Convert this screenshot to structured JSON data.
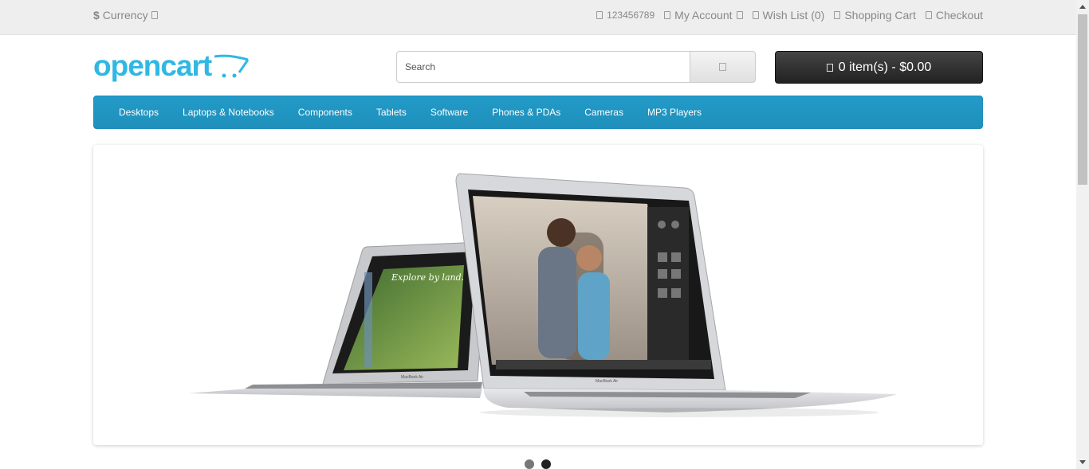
{
  "topbar": {
    "currency_symbol": "$",
    "currency_label": "Currency",
    "phone": "123456789",
    "my_account": "My Account",
    "wish_list": "Wish List (0)",
    "shopping_cart": "Shopping Cart",
    "checkout": "Checkout"
  },
  "header": {
    "logo_text": "opencart",
    "search_placeholder": "Search",
    "cart_label": "0 item(s) - $0.00"
  },
  "menu": {
    "items": [
      "Desktops",
      "Laptops & Notebooks",
      "Components",
      "Tablets",
      "Software",
      "Phones & PDAs",
      "Cameras",
      "MP3 Players"
    ]
  },
  "slideshow": {
    "left_screen_text": "Explore by land.",
    "left_laptop_label": "MacBook Air",
    "right_laptop_label": "MacBook Air",
    "dots": 2,
    "active_dot": 2
  },
  "colors": {
    "brand": "#2fb8e4",
    "menu_bg": "#229ac8",
    "cart_bg": "#333333"
  }
}
